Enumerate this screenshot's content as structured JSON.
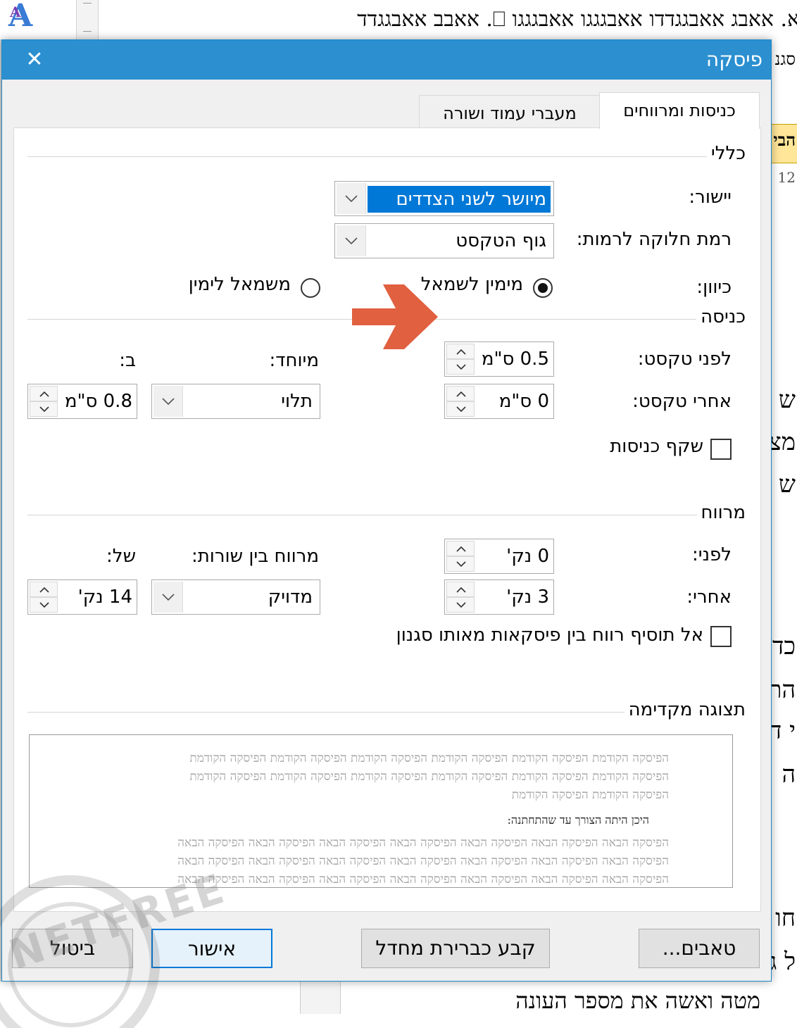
{
  "background": {
    "heading_text": "א. אאבג אאבגגדדו אאבגגגו אאבגגגו ⎕. אאבב אאבגגדד",
    "right_fragments": [
      "סגנ",
      "הבי",
      "12",
      "ש",
      "מצ",
      "ש",
      "כד",
      "הת",
      "י ד",
      "ה",
      "חו",
      "ל ג"
    ],
    "bottom_text": "מטה ואשה את מספר העונה"
  },
  "dialog": {
    "title": "פיסקה",
    "close_glyph": "✕",
    "tabs": [
      {
        "label": "כניסות ומרווחים",
        "active": true
      },
      {
        "label": "מעברי עמוד ושורה",
        "active": false
      }
    ],
    "general": {
      "title": "כללי",
      "alignment_label": "יישור:",
      "alignment_value": "מיושר לשני הצדדים",
      "outline_label": "רמת חלוקה לרמות:",
      "outline_value": "גוף הטקסט",
      "direction_label": "כיוון:",
      "rtl_label": "מימין לשמאל",
      "ltr_label": "משמאל לימין",
      "rtl_selected": true
    },
    "indentation": {
      "title": "כניסה",
      "before_label": "לפני טקסט:",
      "before_value": "0.5  ס\"מ",
      "after_label": "אחרי טקסט:",
      "after_value": "0  ס\"מ",
      "special_label": "מיוחד:",
      "special_value": "תלוי",
      "by_label": "ב:",
      "by_value": "0.8  ס\"מ",
      "mirror_label": "שקף כניסות",
      "mirror_checked": false
    },
    "spacing": {
      "title": "מרווח",
      "before_label": "לפני:",
      "before_value": "0  נק'",
      "after_label": "אחרי:",
      "after_value": "3  נק'",
      "line_label": "מרווח בין שורות:",
      "line_value": "מדויק",
      "at_label": "של:",
      "at_value": "14  נק'",
      "no_space_label": "אל תוסיף רווח בין פיסקאות מאותו סגנון",
      "no_space_checked": false
    },
    "preview": {
      "title": "תצוגה מקדימה",
      "prev_lines": [
        "הפיסקה הקודמת הפיסקה הקודמת הפיסקה הקודמת הפיסקה הקודמת הפיסקה הקודמת הפיסקה הקודמת",
        "הפיסקה הקודמת הפיסקה הקודמת הפיסקה הקודמת הפיסקה הקודמת הפיסקה הקודמת הפיסקה הקודמת",
        "הפיסקה הקודמת הפיסקה הקודמת"
      ],
      "current_line": "היכן היתה הצורך עד שהתחתנה:",
      "next_lines": [
        "הפיסקה הבאה הפיסקה הבאה הפיסקה הבאה הפיסקה הבאה הפיסקה הבאה הפיסקה הבאה הפיסקה הבאה",
        "הפיסקה הבאה הפיסקה הבאה הפיסקה הבאה הפיסקה הבאה הפיסקה הבאה הפיסקה הבאה הפיסקה הבאה",
        "הפיסקה הבאה הפיסקה הבאה הפיסקה הבאה הפיסקה הבאה הפיסקה הבאה הפיסקה הבאה הפיסקה הבאה"
      ]
    },
    "buttons": {
      "tabs": "טאבים...",
      "set_default": "קבע כברירת מחדל",
      "ok": "אישור",
      "cancel": "ביטול"
    }
  },
  "annotation": {
    "arrow_color": "#e0603f"
  },
  "watermark": {
    "text": "NETFREE"
  },
  "colors": {
    "titlebar": "#2b8fd0",
    "selection": "#0078d7",
    "accent_arrow": "#e0603f"
  }
}
